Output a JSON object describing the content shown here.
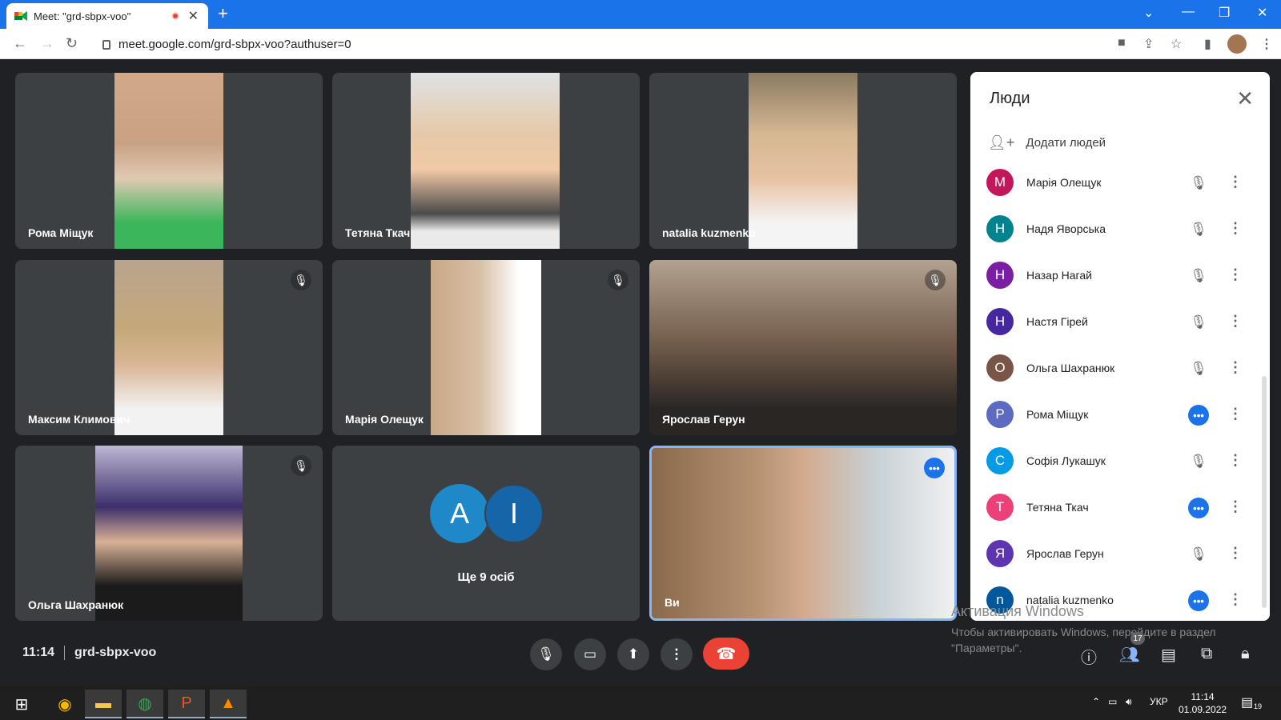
{
  "browser": {
    "tab_title": "Meet: \"grd-sbpx-voo\"",
    "url": "meet.google.com/grd-sbpx-voo?authuser=0"
  },
  "tiles": [
    {
      "name": "Рома Міщук",
      "muted": false
    },
    {
      "name": "Тетяна Ткач",
      "muted": false
    },
    {
      "name": "natalia kuzmenko",
      "muted": false
    },
    {
      "name": "Максим Климович",
      "muted": true
    },
    {
      "name": "Марія Олещук",
      "muted": true
    },
    {
      "name": "Ярослав Герун",
      "muted": true
    },
    {
      "name": "Ольга Шахранюк",
      "muted": true
    },
    {
      "name": "Ви",
      "muted": false
    }
  ],
  "more_tile": {
    "avatar1": "A",
    "avatar2": "I",
    "label": "Ще 9 осіб"
  },
  "panel": {
    "title": "Люди",
    "add_people": "Додати людей",
    "participants": [
      {
        "initial": "М",
        "name": "Марія Олещук",
        "color": "#c2185b",
        "speaking": false
      },
      {
        "initial": "Н",
        "name": "Надя Яворська",
        "color": "#00838f",
        "speaking": false
      },
      {
        "initial": "Н",
        "name": "Назар Нагай",
        "color": "#7b1fa2",
        "speaking": false
      },
      {
        "initial": "Н",
        "name": "Настя Гірей",
        "color": "#4527a0",
        "speaking": false
      },
      {
        "initial": "О",
        "name": "Ольга Шахранюк",
        "color": "#795548",
        "speaking": false
      },
      {
        "initial": "Р",
        "name": "Рома Міщук",
        "color": "#5c6bc0",
        "speaking": true
      },
      {
        "initial": "С",
        "name": "Софія Лукашук",
        "color": "#039be5",
        "speaking": false
      },
      {
        "initial": "Т",
        "name": "Тетяна Ткач",
        "color": "#ec407a",
        "speaking": true
      },
      {
        "initial": "Я",
        "name": "Ярослав Герун",
        "color": "#5e35b1",
        "speaking": false
      },
      {
        "initial": "n",
        "name": "natalia kuzmenko",
        "color": "#01579b",
        "speaking": true
      }
    ]
  },
  "watermark": {
    "line1": "Активация Windows",
    "line2": "Чтобы активировать Windows, перейдите в раздел",
    "line3": "\"Параметры\"."
  },
  "meeting": {
    "time": "11:14",
    "code": "grd-sbpx-voo",
    "people_count": "17"
  },
  "taskbar": {
    "lang": "УКР",
    "time": "11:14",
    "date": "01.09.2022",
    "notif_count": "19"
  }
}
